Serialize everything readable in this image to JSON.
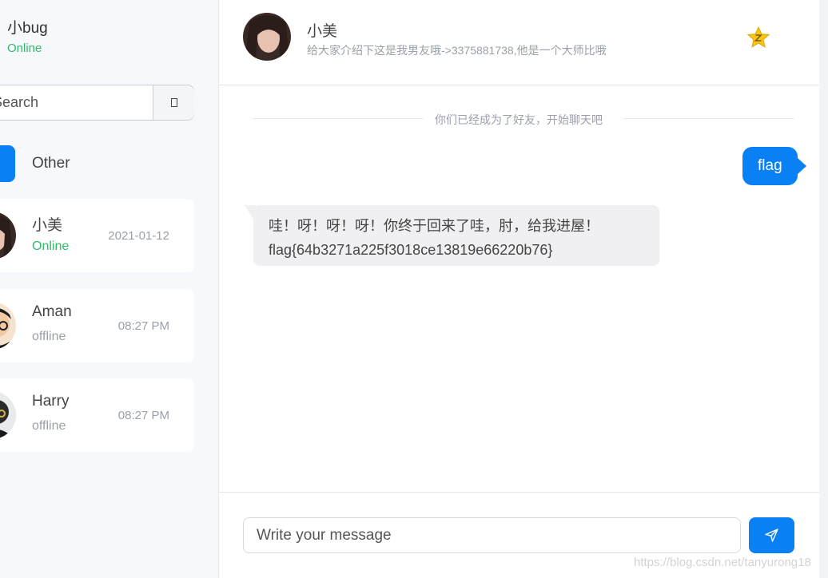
{
  "current_user": {
    "name": "小bug",
    "status": "Online"
  },
  "search": {
    "placeholder": "Search"
  },
  "tabs": {
    "active_label": "",
    "other_label": "Other"
  },
  "contacts": [
    {
      "name": "小美",
      "status": "Online",
      "time": "2021-01-12"
    },
    {
      "name": "Aman",
      "status": "offline",
      "time": "08:27 PM"
    },
    {
      "name": "Harry",
      "status": "offline",
      "time": "08:27 PM"
    }
  ],
  "chat": {
    "name": "小美",
    "subtitle": "给大家介绍下这是我男友哦->3375881738,他是一个大师比哦",
    "star_icon": "star-icon",
    "divider_text": "你们已经成为了好友，开始聊天吧",
    "messages": [
      {
        "direction": "outgoing",
        "text": "flag"
      },
      {
        "direction": "incoming",
        "line1": "哇！呀！呀！呀！你终于回来了哇，肘，给我进屋！",
        "line2": "flag{64b3271a225f3018ce13819e66220b76}"
      }
    ]
  },
  "composer": {
    "placeholder": "Write your message",
    "send_icon": "send-icon"
  },
  "watermark": "https://blog.csdn.net/tanyurong18",
  "colors": {
    "accent": "#0a80f5",
    "online": "#2dbb6a",
    "muted": "#9aa0aa",
    "star": "#f5c518"
  }
}
